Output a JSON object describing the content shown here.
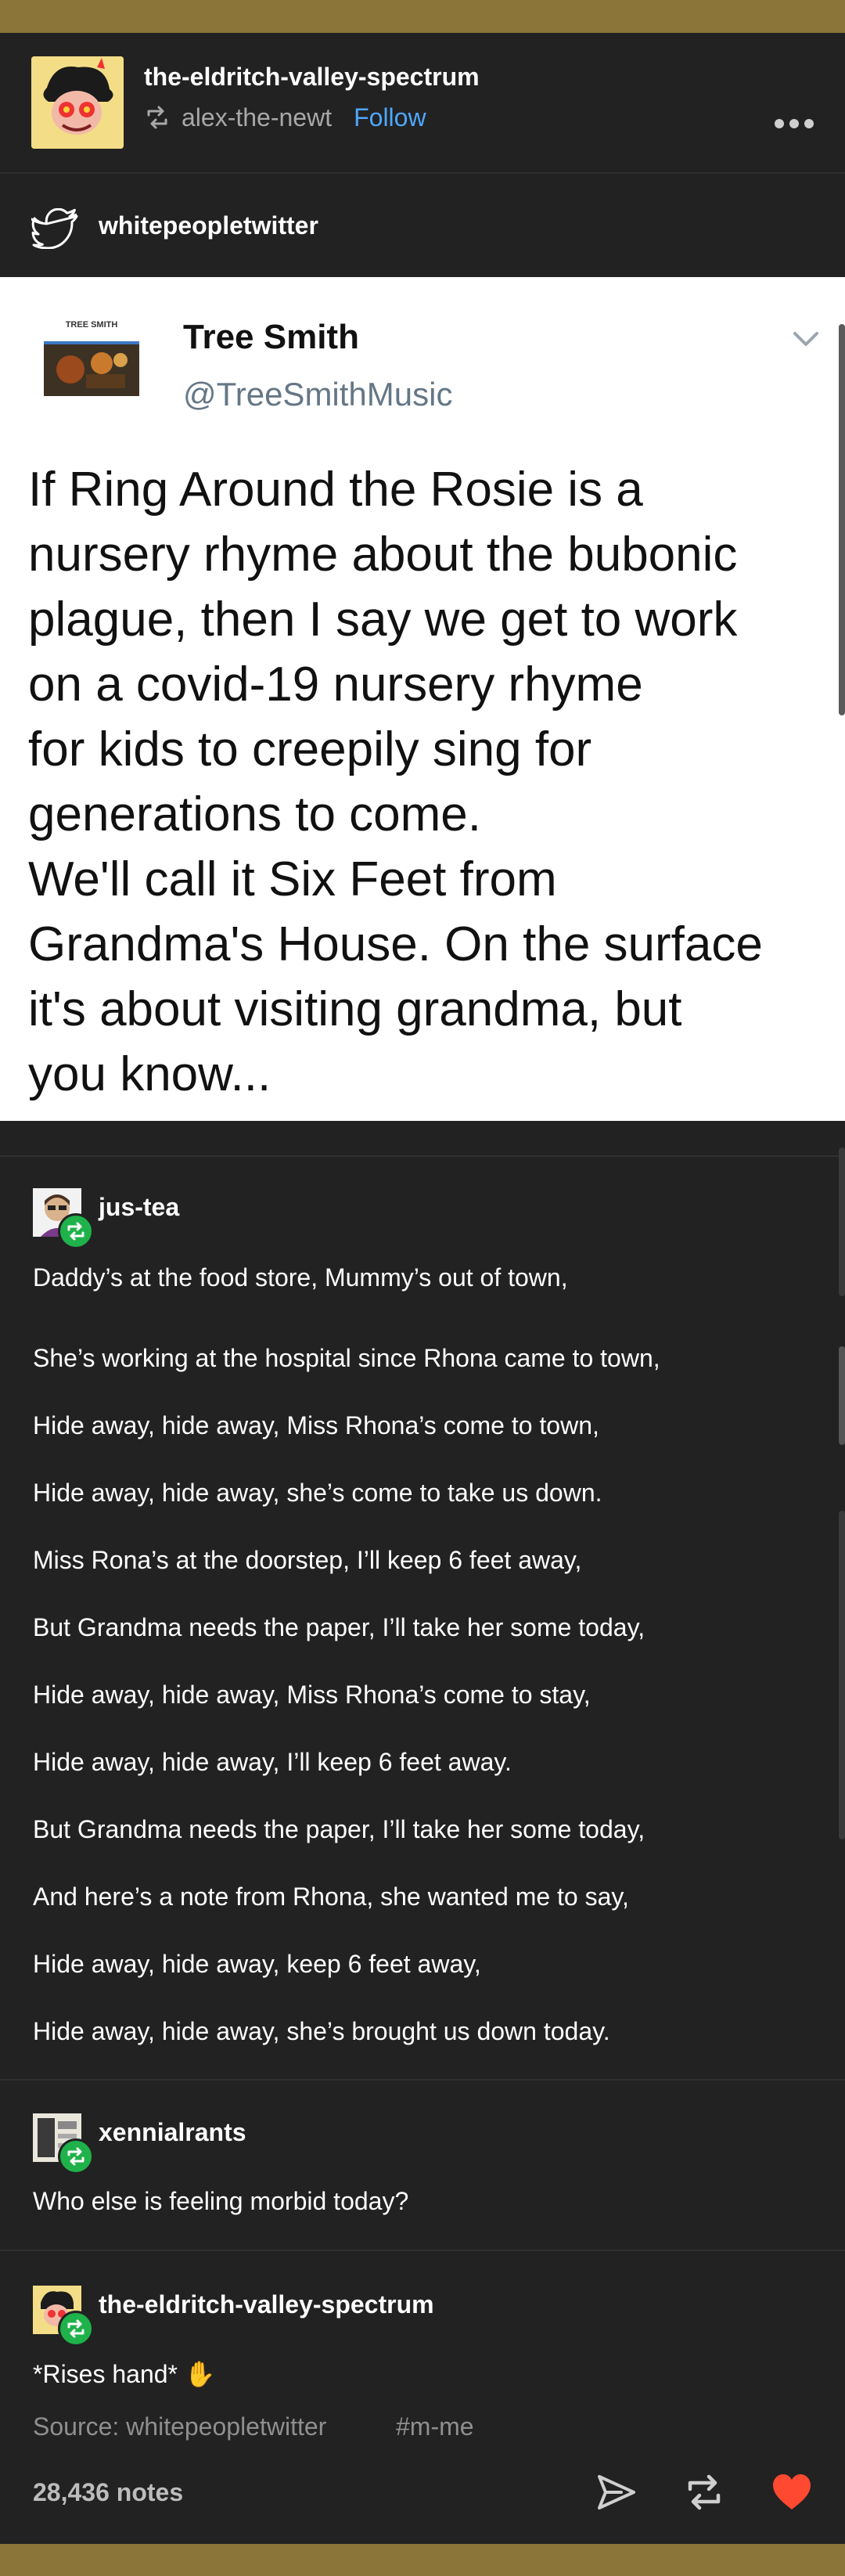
{
  "post": {
    "blog_name": "the-eldritch-valley-spectrum",
    "reblogged_from": "alex-the-newt",
    "follow_label": "Follow"
  },
  "source": {
    "name": "whitepeopletwitter"
  },
  "tweet": {
    "avatar_caption": "TREE SMITH",
    "author_name": "Tree Smith",
    "author_handle": "@TreeSmithMusic",
    "text": "If Ring Around the Rosie is a\nnursery rhyme about the bubonic\nplague, then I say we get to work\non a covid-19 nursery rhyme\nfor kids to creepily sing for\ngenerations to come.\nWe'll call it Six Feet from\nGrandma's House. On the surface\nit's about visiting grandma, but\nyou know..."
  },
  "trail": [
    {
      "user": "jus-tea",
      "lines": [
        "Daddy’s at the food store, Mummy’s out of town,",
        "She’s working at the hospital since Rhona came to town,",
        "Hide away, hide away, Miss Rhona’s come to town,",
        "Hide away, hide away, she’s come to take us down.",
        "Miss Rona’s at the doorstep, I’ll keep 6 feet away,",
        "But Grandma needs the paper, I’ll take her some today,",
        "Hide away, hide away, Miss Rhona’s come to stay,",
        "Hide away, hide away, I’ll keep 6 feet away.",
        "But Grandma needs the paper, I’ll take her some today,",
        "And here’s a note from Rhona, she wanted me to say,",
        "Hide away, hide away, keep 6 feet away,",
        "Hide away, hide away, she’s brought us down today."
      ]
    },
    {
      "user": "xennialrants",
      "lines": [
        "Who else is feeling morbid today?"
      ]
    },
    {
      "user": "the-eldritch-valley-spectrum",
      "lines": [
        "*Rises hand* ✋"
      ]
    }
  ],
  "footer": {
    "source_label": "Source: whitepeopletwitter",
    "tag": "#m-me",
    "notes": "28,436 notes"
  },
  "colors": {
    "frame": "#8b7539",
    "background": "#222222",
    "follow_link": "#4ea7ff",
    "reblog_badge": "#1fb24a",
    "like_heart": "#ff4930"
  },
  "icons": {
    "reblog": "reblog-icon",
    "more": "more-options-icon",
    "twitter": "twitter-bird-icon",
    "share": "share-icon",
    "like": "heart-icon"
  }
}
